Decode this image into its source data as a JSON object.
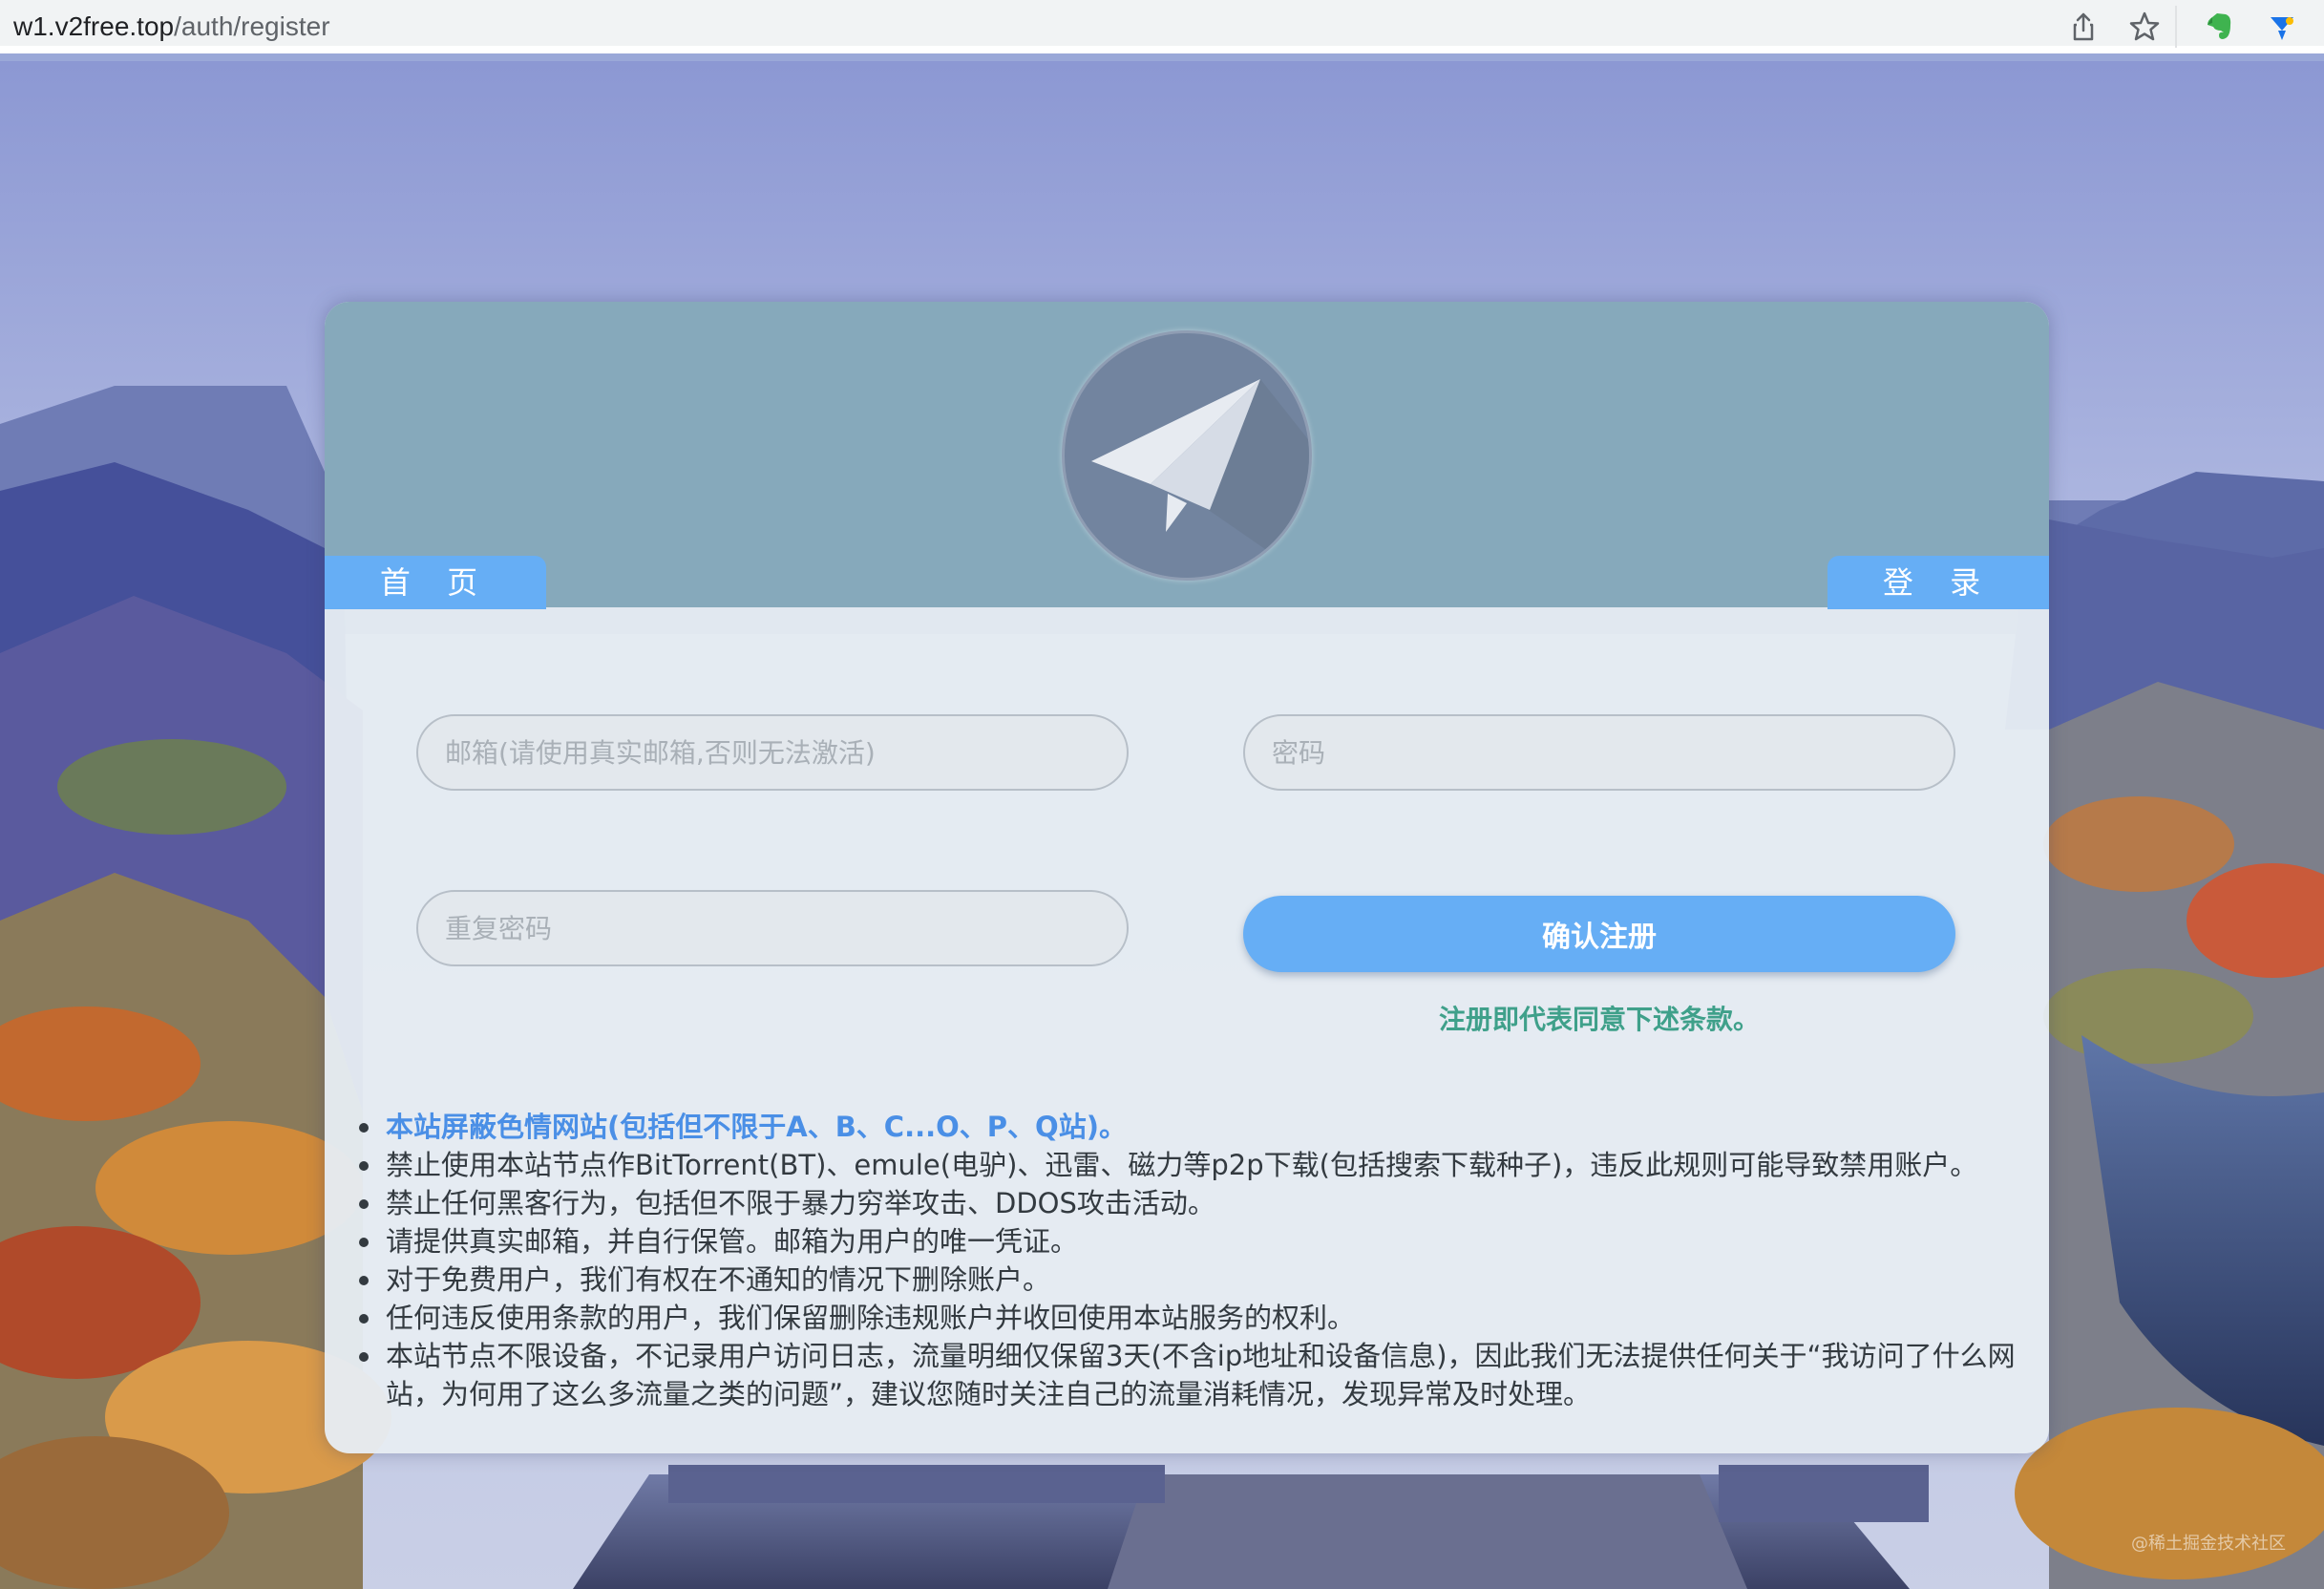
{
  "browser": {
    "url_host": "w1.v2free.top",
    "url_path": "/auth/register",
    "icons": [
      "share-icon",
      "star-icon",
      "evernote-icon",
      "extension-icon"
    ]
  },
  "header": {
    "home_tab": "首 页",
    "login_tab": "登 录",
    "logo_icon": "paper-plane-icon"
  },
  "form": {
    "email_placeholder": "邮箱(请使用真实邮箱,否则无法激活)",
    "password_placeholder": "密码",
    "repeat_placeholder": "重复密码",
    "submit_label": "确认注册",
    "agree_text": "注册即代表同意下述条款。"
  },
  "terms": [
    "本站屏蔽色情网站(包括但不限于A、B、C...O、P、Q站)。",
    "禁止使用本站节点作BitTorrent(BT)、emule(电驴)、迅雷、磁力等p2p下载(包括搜索下载种子)，违反此规则可能导致禁用账户。",
    "禁止任何黑客行为，包括但不限于暴力穷举攻击、DDOS攻击活动。",
    "请提供真实邮箱，并自行保管。邮箱为用户的唯一凭证。",
    "对于免费用户，我们有权在不通知的情况下删除账户。",
    "任何违反使用条款的用户，我们保留删除违规账户并收回使用本站服务的权利。",
    "本站节点不限设备，不记录用户访问日志，流量明细仅保留3天(不含ip地址和设备信息)，因此我们无法提供任何关于“我访问了什么网站，为何用了这么多流量之类的问题”，建议您随时关注自己的流量消耗情况，发现异常及时处理。"
  ],
  "watermark": "@稀土掘金技术社区",
  "colors": {
    "accent": "#66aef5",
    "header": "#86a9bb",
    "agree": "#3fa08a",
    "warning": "#4a8fe6"
  }
}
